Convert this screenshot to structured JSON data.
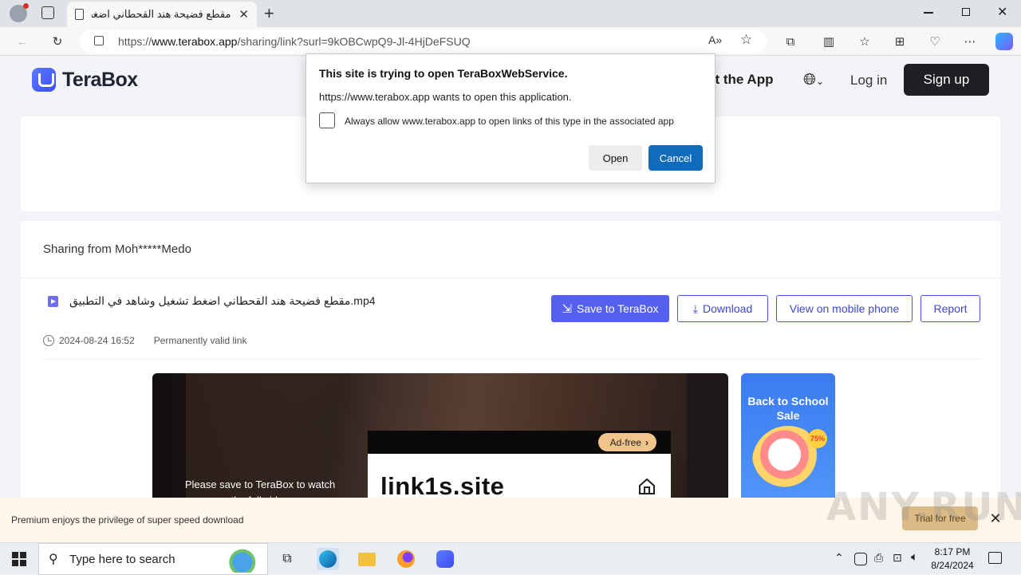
{
  "browser": {
    "tab_title": "مقطع فضيحة هند القحطاني اضغط",
    "url_prefix": "https://",
    "url_domain": "www.terabox.app",
    "url_path": "/sharing/link?surl=9kOBCwpQ9-Jl-4HjDeFSUQ"
  },
  "site": {
    "logo_text": "TeraBox",
    "nav_get_app": "et the App",
    "nav_login": "Log in",
    "nav_signup": "Sign up"
  },
  "share": {
    "sharing_from": "Sharing from Moh*****Medo",
    "file_name": "مقطع فضيحة هند القحطاني اضغط تشغيل وشاهد في التطبيق.mp4",
    "date": "2024-08-24 16:52",
    "validity": "Permanently valid link",
    "btn_save": "Save to TeraBox",
    "btn_download": "Download",
    "btn_mobile": "View on mobile phone",
    "btn_report": "Report",
    "video_message": "Please save to TeraBox to watch the full video",
    "ad_free": "Ad-free",
    "ad_domain": "link1s.site",
    "promo_title": "Back to School Sale",
    "promo_badge": "75%"
  },
  "banner": {
    "text": "Premium enjoys the privilege of super speed download",
    "trial": "Trial for free",
    "watermark": "ANY.RUN"
  },
  "dialog": {
    "title": "This site is trying to open TeraBoxWebService.",
    "message": "https://www.terabox.app wants to open this application.",
    "checkbox_label": "Always allow www.terabox.app to open links of this type in the associated app",
    "open": "Open",
    "cancel": "Cancel"
  },
  "taskbar": {
    "search_placeholder": "Type here to search",
    "time": "8:17 PM",
    "date": "8/24/2024"
  },
  "colors": {
    "accent": "#5561ee",
    "dialog_primary": "#0f6cbd",
    "signup_bg": "#1f2023"
  }
}
